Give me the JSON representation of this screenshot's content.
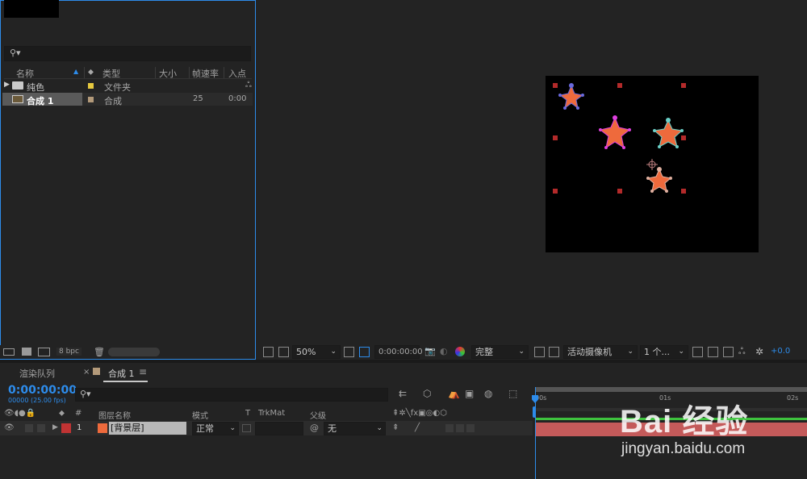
{
  "project": {
    "columns": {
      "name": "名称",
      "type": "类型",
      "size": "大小",
      "fps": "帧速率",
      "in": "入点"
    },
    "rows": [
      {
        "name": "纯色",
        "type": "文件夹",
        "fps": "",
        "in": "",
        "label_color": "#e6c93f"
      },
      {
        "name": "合成 1",
        "type": "合成",
        "fps": "25",
        "in": "0:00",
        "label_color": "#b39a7a"
      }
    ],
    "bpc": "8 bpc"
  },
  "viewer": {
    "zoom": "50%",
    "timecode": "0:00:00:00",
    "resolution": "完整",
    "camera": "活动摄像机",
    "views": "1 个...",
    "exposure": "+0.0"
  },
  "timeline": {
    "tabs": {
      "render_queue": "渲染队列",
      "close": "×",
      "comp": "合成 1",
      "menu": "≡"
    },
    "timecode": "0:00:00:00",
    "fps": "00000 (25.00 fps)",
    "columns": {
      "num": "#",
      "layer_name": "图层名称",
      "mode": "模式",
      "t": "T",
      "trkmat": "TrkMat",
      "parent": "父级"
    },
    "layer": {
      "index": "1",
      "name": "[背景层]",
      "mode": "正常",
      "parent": "无",
      "color": "#c03333"
    },
    "ruler": {
      "t0": "00s",
      "t1": "01s",
      "t2": "02s"
    }
  },
  "watermark": {
    "brand": "Bai 经验",
    "url": "jingyan.baidu.com"
  },
  "colors": {
    "accent": "#2d8ceb",
    "star": "#ee6a3c",
    "layer_bar": "#c45a5a",
    "track_green": "#3ec33e"
  }
}
